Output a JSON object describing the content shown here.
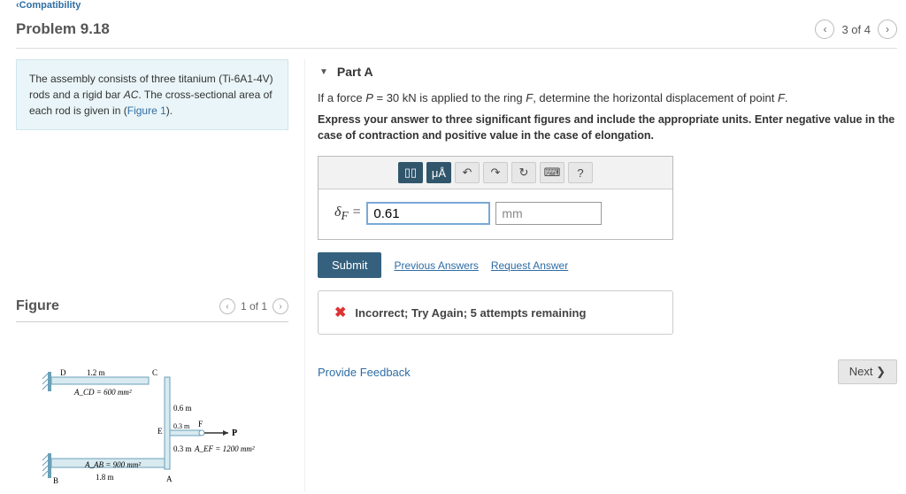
{
  "breadcrumb": "‹Compatibility",
  "problem": {
    "title": "Problem 9.18",
    "position": "3 of 4"
  },
  "intro": {
    "text_before": "The assembly consists of three titanium (Ti-6A1-4V) rods and a rigid bar ",
    "bar": "AC",
    "text_mid": ". The cross-sectional area of each rod is given in (",
    "figref": "Figure 1",
    "text_after": ")."
  },
  "figure": {
    "heading": "Figure",
    "position": "1 of 1"
  },
  "figure_labels": {
    "D": "D",
    "C": "C",
    "B": "B",
    "A": "A",
    "E": "E",
    "F": "F",
    "P": "P",
    "len_dc": "1.2 m",
    "len_ba": "1.8 m",
    "len_cf_top": "0.6 m",
    "len_ef": "0.3 m",
    "len_fa": "0.3 m",
    "area_cd": "A_CD = 600 mm²",
    "area_ab": "A_AB = 900 mm²",
    "area_ef": "A_EF = 1200 mm²"
  },
  "partA": {
    "label": "Part A",
    "question_pre": "If a force ",
    "P": "P",
    "eq": " = 30 kN",
    "question_mid": " is applied to the ring ",
    "F1": "F",
    "question_mid2": ", determine the horizontal displacement of point ",
    "F2": "F",
    "question_end": ".",
    "instructions": "Express your answer to three significant figures and include the appropriate units. Enter negative value in the case of contraction and positive value in the case of elongation.",
    "toolbar": {
      "prefix": "μÅ",
      "help": "?"
    },
    "delta_label": "δ_F =",
    "value": "0.61",
    "unit": "mm",
    "submit": "Submit",
    "prev": "Previous Answers",
    "request": "Request Answer",
    "feedback": "Incorrect; Try Again; 5 attempts remaining"
  },
  "footer": {
    "provide": "Provide Feedback",
    "next": "Next ❯"
  }
}
